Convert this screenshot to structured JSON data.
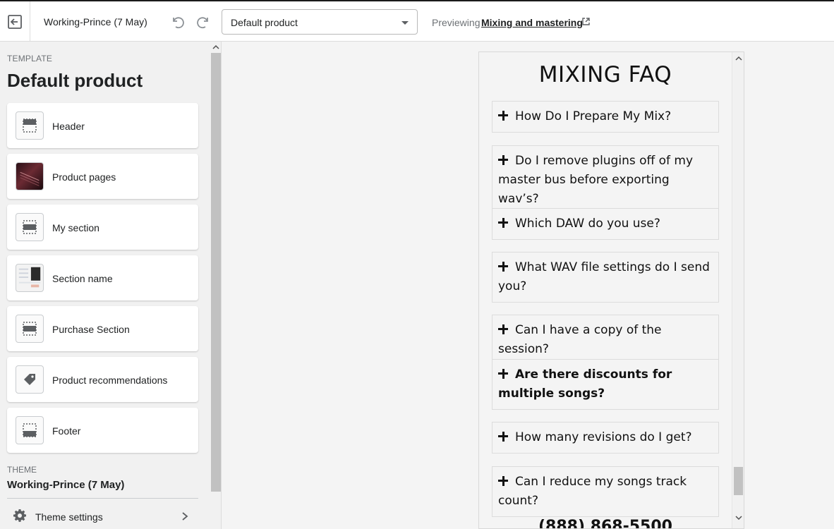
{
  "topbar": {
    "theme_name": "Working-Prince (7 May)",
    "template_select": "Default product",
    "previewing_label": "Previewing",
    "previewing_link": "Mixing and mastering"
  },
  "sidebar": {
    "template_label": "TEMPLATE",
    "template_title": "Default product",
    "sections": [
      {
        "label": "Header",
        "icon": "header-layout-icon"
      },
      {
        "label": "Product pages",
        "icon": "product-image-thumb"
      },
      {
        "label": "My section",
        "icon": "section-layout-icon"
      },
      {
        "label": "Section name",
        "icon": "section-preview-thumb"
      },
      {
        "label": "Purchase Section",
        "icon": "section-layout-icon"
      },
      {
        "label": "Product recommendations",
        "icon": "tag-icon"
      },
      {
        "label": "Footer",
        "icon": "footer-layout-icon"
      }
    ],
    "theme_label": "THEME",
    "theme_value": "Working-Prince (7 May)",
    "theme_settings": "Theme settings"
  },
  "preview": {
    "faq_title": "MIXING FAQ",
    "faq_items": [
      {
        "q": "How Do I Prepare My Mix?",
        "bold": false
      },
      {
        "q": "Do I remove plugins off of my master bus before exporting wav’s?",
        "bold": false
      },
      {
        "q": "Which DAW do you use?",
        "bold": false
      },
      {
        "q": "What WAV file settings do I send you?",
        "bold": false
      },
      {
        "q": "Can I have a copy of the session?",
        "bold": false
      },
      {
        "q": "Are there discounts for multiple songs?",
        "bold": true
      },
      {
        "q": "How many revisions do I get?",
        "bold": false
      },
      {
        "q": "Can I reduce my songs track count?",
        "bold": false
      }
    ],
    "bottom_peek": "(888) 868-5500"
  },
  "colors": {
    "topbar_bg": "#ffffff",
    "sidebar_bg": "#f1f1f1",
    "preview_bg": "#f4f4f4",
    "text": "#202223",
    "muted": "#6d7175"
  }
}
